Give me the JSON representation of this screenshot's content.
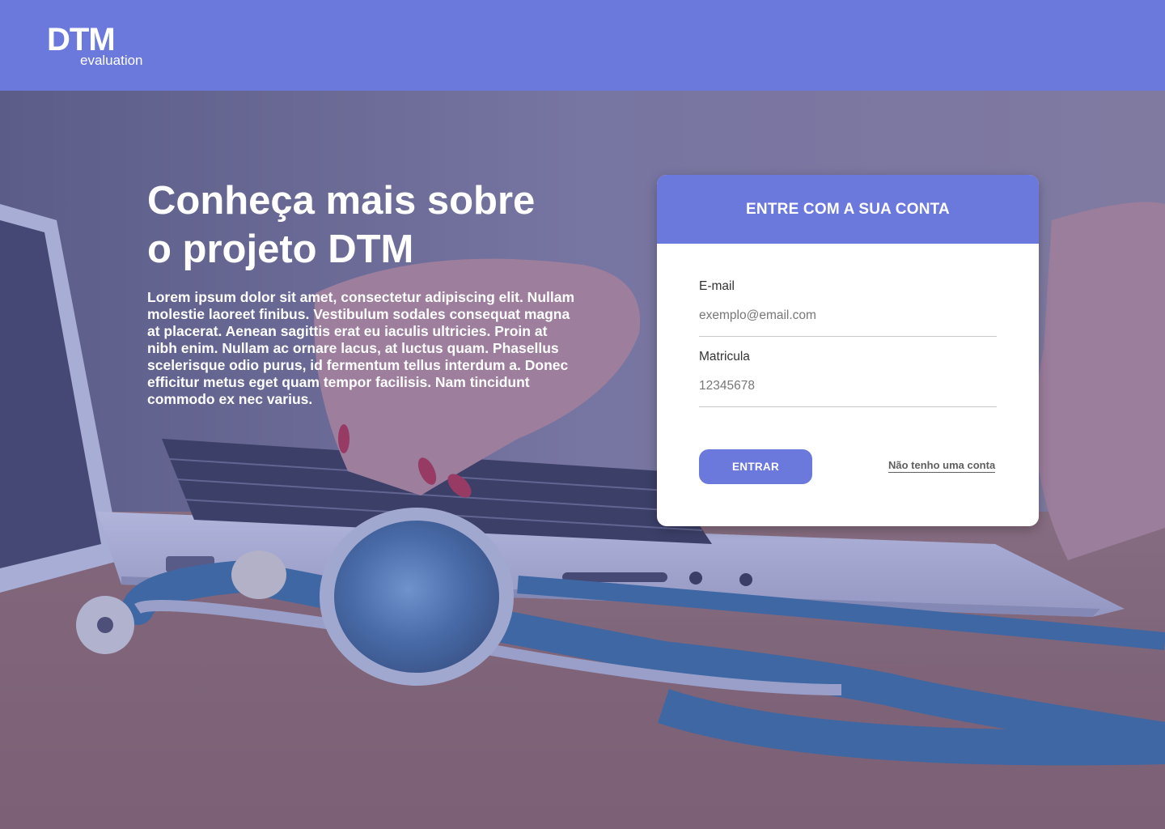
{
  "header": {
    "logo_title": "DTM",
    "logo_subtitle": "evaluation",
    "background_color": "#6b78dc"
  },
  "hero": {
    "headline_line1": "Conheça mais sobre",
    "headline_line2": "o projeto DTM",
    "description": "Lorem ipsum dolor sit amet, consectetur adipiscing elit. Nullam molestie laoreet finibus. Vestibulum sodales consequat magna at placerat. Aenean sagittis erat eu iaculis ultricies. Proin at nibh enim. Nullam ac ornare lacus, at luctus quam. Phasellus scelerisque odio purus, id fermentum tellus interdum a. Donec efficitur metus eget quam tempor facilisis. Nam tincidunt commodo ex nec varius.",
    "background_icon": "laptop-stethoscope-photo"
  },
  "login": {
    "title": "ENTRE COM A SUA CONTA",
    "email": {
      "label": "E-mail",
      "placeholder": "exemplo@email.com",
      "value": ""
    },
    "matricula": {
      "label": "Matricula",
      "placeholder": "12345678",
      "value": ""
    },
    "submit_label": "ENTRAR",
    "signup_link": "Não tenho uma conta",
    "accent_color": "#6b78dc"
  }
}
